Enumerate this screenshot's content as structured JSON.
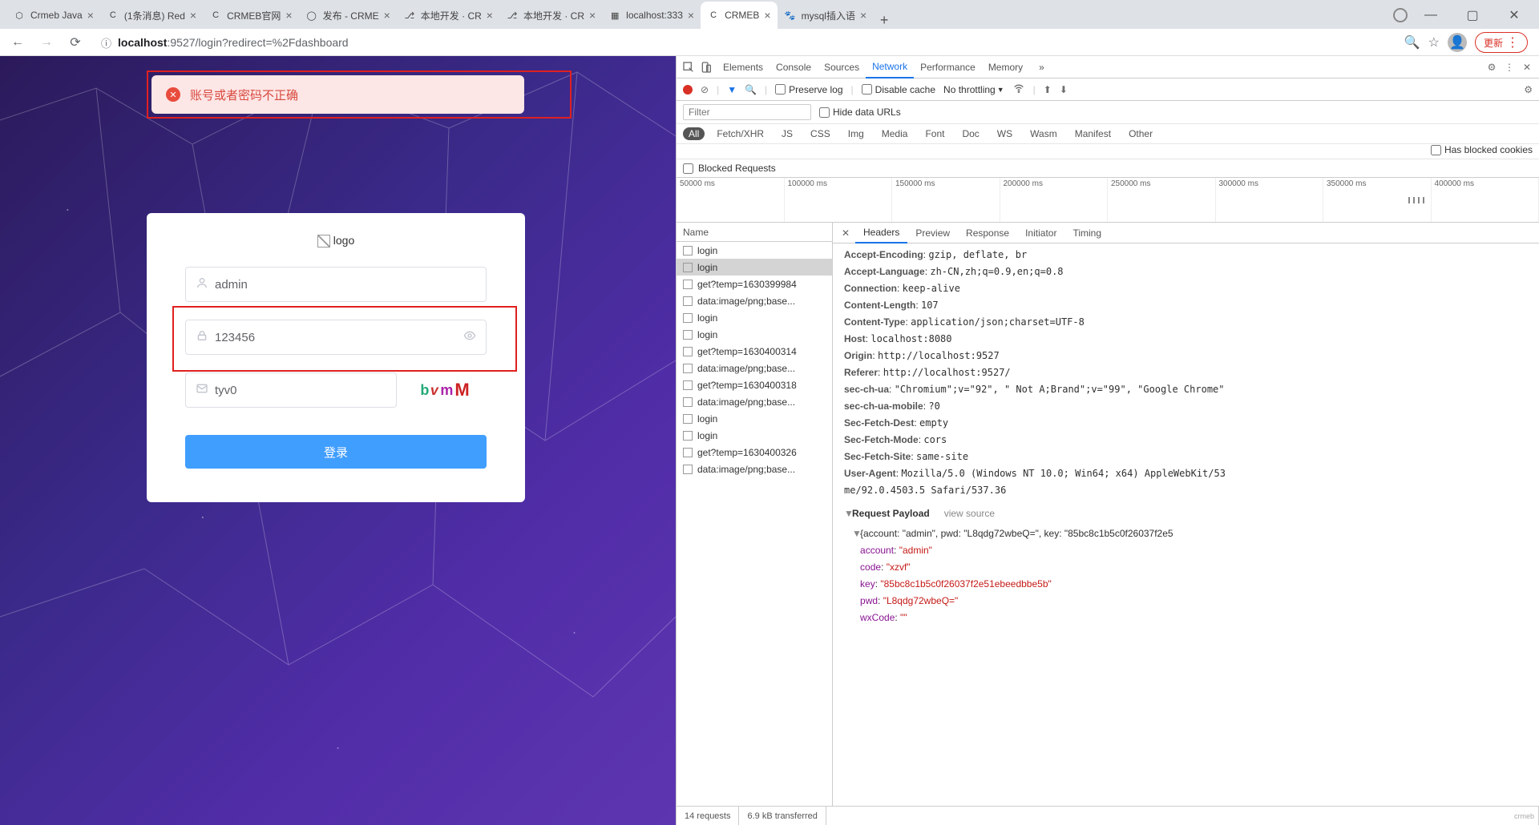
{
  "browser": {
    "tabs": [
      {
        "title": "Crmeb Java",
        "fav": "⬡"
      },
      {
        "title": "(1条消息) Red",
        "fav": "C"
      },
      {
        "title": "CRMEB官网",
        "fav": "C"
      },
      {
        "title": "发布 - CRME",
        "fav": "◯"
      },
      {
        "title": "本地开发 · CR",
        "fav": "⎇"
      },
      {
        "title": "本地开发 · CR",
        "fav": "⎇"
      },
      {
        "title": "localhost:333",
        "fav": "▦"
      },
      {
        "title": "CRMEB",
        "fav": "C",
        "active": true
      },
      {
        "title": "mysql插入语",
        "fav": "🐾"
      }
    ],
    "url_host": "localhost",
    "url_path": ":9527/login?redirect=%2Fdashboard",
    "secure_icon": "ⓘ",
    "update_label": "更新"
  },
  "login": {
    "logo_alt": "logo",
    "error_msg": "账号或者密码不正确",
    "username": "admin",
    "password": "123456",
    "captcha": "tyv0",
    "captcha_img": [
      "b",
      "v",
      "m",
      "M"
    ],
    "submit": "登录"
  },
  "devtools": {
    "main_tabs": [
      "Elements",
      "Console",
      "Sources",
      "Network",
      "Performance",
      "Memory"
    ],
    "active_main": "Network",
    "preserve_log": "Preserve log",
    "disable_cache": "Disable cache",
    "throttling": "No throttling",
    "filter_placeholder": "Filter",
    "hide_urls": "Hide data URLs",
    "chips": [
      "All",
      "Fetch/XHR",
      "JS",
      "CSS",
      "Img",
      "Media",
      "Font",
      "Doc",
      "WS",
      "Wasm",
      "Manifest",
      "Other"
    ],
    "has_blocked": "Has blocked cookies",
    "blocked_req": "Blocked Requests",
    "timeline_ticks": [
      "50000 ms",
      "100000 ms",
      "150000 ms",
      "200000 ms",
      "250000 ms",
      "300000 ms",
      "350000 ms",
      "400000 ms"
    ],
    "name_col": "Name",
    "requests": [
      {
        "n": "login"
      },
      {
        "n": "login",
        "sel": true
      },
      {
        "n": "get?temp=1630399984"
      },
      {
        "n": "data:image/png;base..."
      },
      {
        "n": "login"
      },
      {
        "n": "login"
      },
      {
        "n": "get?temp=1630400314"
      },
      {
        "n": "data:image/png;base..."
      },
      {
        "n": "get?temp=1630400318"
      },
      {
        "n": "data:image/png;base..."
      },
      {
        "n": "login"
      },
      {
        "n": "login"
      },
      {
        "n": "get?temp=1630400326"
      },
      {
        "n": "data:image/png;base..."
      }
    ],
    "detail_tabs": [
      "Headers",
      "Preview",
      "Response",
      "Initiator",
      "Timing"
    ],
    "active_detail": "Headers",
    "headers": [
      {
        "k": "Accept-Encoding",
        "v": "gzip, deflate, br"
      },
      {
        "k": "Accept-Language",
        "v": "zh-CN,zh;q=0.9,en;q=0.8"
      },
      {
        "k": "Connection",
        "v": "keep-alive"
      },
      {
        "k": "Content-Length",
        "v": "107"
      },
      {
        "k": "Content-Type",
        "v": "application/json;charset=UTF-8"
      },
      {
        "k": "Host",
        "v": "localhost:8080"
      },
      {
        "k": "Origin",
        "v": "http://localhost:9527"
      },
      {
        "k": "Referer",
        "v": "http://localhost:9527/"
      },
      {
        "k": "sec-ch-ua",
        "v": "\"Chromium\";v=\"92\", \" Not A;Brand\";v=\"99\", \"Google Chrome\""
      },
      {
        "k": "sec-ch-ua-mobile",
        "v": "?0"
      },
      {
        "k": "Sec-Fetch-Dest",
        "v": "empty"
      },
      {
        "k": "Sec-Fetch-Mode",
        "v": "cors"
      },
      {
        "k": "Sec-Fetch-Site",
        "v": "same-site"
      },
      {
        "k": "User-Agent",
        "v": "Mozilla/5.0 (Windows NT 10.0; Win64; x64) AppleWebKit/53"
      }
    ],
    "ua_line2": "me/92.0.4503.5 Safari/537.36",
    "payload_title": "Request Payload",
    "view_source": "view source",
    "payload_summary": "{account: \"admin\", pwd: \"L8qdg72wbeQ=\", key: \"85bc8c1b5c0f26037f2e5",
    "payload": [
      {
        "k": "account",
        "v": "\"admin\""
      },
      {
        "k": "code",
        "v": "\"xzvf\""
      },
      {
        "k": "key",
        "v": "\"85bc8c1b5c0f26037f2e51ebeedbbe5b\""
      },
      {
        "k": "pwd",
        "v": "\"L8qdg72wbeQ=\""
      },
      {
        "k": "wxCode",
        "v": "\"\""
      }
    ],
    "status_requests": "14 requests",
    "status_transfer": "6.9 kB transferred",
    "crmeb": "crmeb"
  }
}
